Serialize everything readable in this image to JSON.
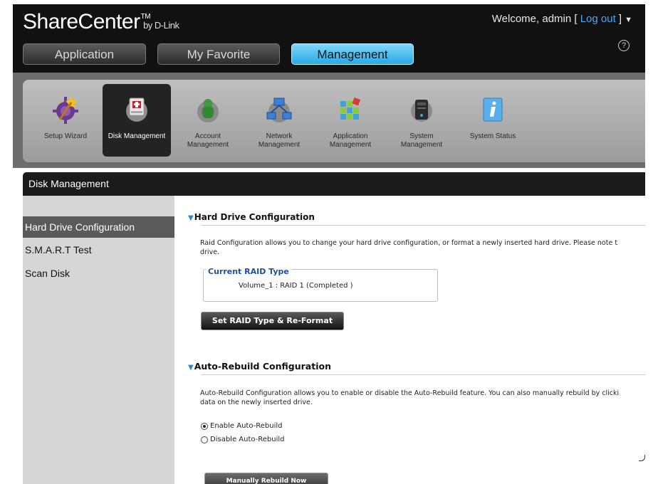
{
  "header": {
    "brand": "ShareCenter",
    "brand_tm": "TM",
    "brand_by": "by D-Link",
    "welcome_prefix": "Welcome, admin [ ",
    "logout_label": "Log out",
    "welcome_suffix": " ]",
    "menu_caret": "▼",
    "help_glyph": "?"
  },
  "tabs": [
    {
      "label": "Application",
      "active": false
    },
    {
      "label": "My Favorite",
      "active": false
    },
    {
      "label": "Management",
      "active": true
    }
  ],
  "toolbar": {
    "items": [
      {
        "label": "Setup Wizard",
        "icon": "wizard-icon",
        "active": false
      },
      {
        "label": "Disk Management",
        "icon": "disk-icon",
        "active": true
      },
      {
        "label": "Account Management",
        "icon": "account-icon",
        "active": false
      },
      {
        "label": "Network Management",
        "icon": "network-icon",
        "active": false
      },
      {
        "label": "Application Management",
        "icon": "application-icon",
        "active": false
      },
      {
        "label": "System Management",
        "icon": "system-icon",
        "active": false
      },
      {
        "label": "System Status",
        "icon": "info-icon",
        "active": false
      }
    ]
  },
  "panel": {
    "title": "Disk Management"
  },
  "sidebar": {
    "items": [
      {
        "label": "Hard Drive Configuration",
        "active": true
      },
      {
        "label": "S.M.A.R.T Test",
        "active": false
      },
      {
        "label": "Scan Disk",
        "active": false
      }
    ]
  },
  "hdc": {
    "title": "Hard Drive Configuration",
    "desc_line1": "Raid Configuration allows you to change your hard drive configuration, or format a newly inserted hard drive. Please note t",
    "desc_line2": "drive.",
    "raid_legend": "Current RAID Type",
    "raid_value": "Volume_1 : RAID 1 (Completed )",
    "button": "Set RAID Type & Re-Format"
  },
  "arc": {
    "title": "Auto-Rebuild Configuration",
    "desc_line1": "Auto-Rebuild Configuration allows you to enable or disable the Auto-Rebuild feature. You can also manually rebuild by clicki",
    "desc_line2": "data on the newly inserted drive.",
    "options": [
      {
        "label": "Enable Auto-Rebuild",
        "checked": true
      },
      {
        "label": "Disable Auto-Rebuild",
        "checked": false
      }
    ],
    "button": "Manually Rebuild Now"
  }
}
